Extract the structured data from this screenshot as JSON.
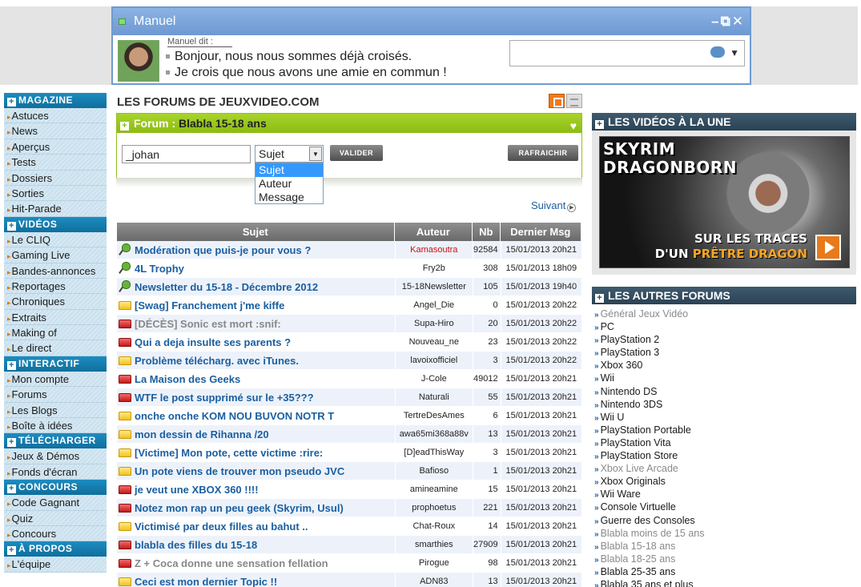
{
  "chat": {
    "contact_name": "Manuel",
    "window_controls": "–⧉✕",
    "speaker_label": "Manuel dit :",
    "messages": [
      "Bonjour, nous nous sommes déjà croisés.",
      "Je crois que nous avons une amie en commun !"
    ],
    "input_value": ""
  },
  "sidebar": {
    "sections": [
      {
        "title": "MAGAZINE",
        "items": [
          "Astuces",
          "News",
          "Aperçus",
          "Tests",
          "Dossiers",
          "Sorties",
          "Hit-Parade"
        ]
      },
      {
        "title": "VIDÉOS",
        "items": [
          "Le CLIQ",
          "Gaming Live",
          "Bandes-annonces",
          "Reportages",
          "Chroniques",
          "Extraits",
          "Making of",
          "Le direct"
        ]
      },
      {
        "title": "INTERACTIF",
        "items": [
          "Mon compte",
          "Forums",
          "Les Blogs",
          "Boîte à idées"
        ]
      },
      {
        "title": "TÉLÉCHARGER",
        "items": [
          "Jeux & Démos",
          "Fonds d'écran"
        ]
      },
      {
        "title": "CONCOURS",
        "items": [
          "Code Gagnant",
          "Quiz",
          "Concours"
        ]
      },
      {
        "title": "À PROPOS",
        "items": [
          "L'équipe"
        ]
      }
    ]
  },
  "main": {
    "title": "LES FORUMS DE JEUXVIDEO.COM",
    "forum_label": "Forum :",
    "forum_name": "Blabla 15-18 ans",
    "search_value": "_johan",
    "select_value": "Sujet",
    "select_options": [
      "Sujet",
      "Auteur",
      "Message"
    ],
    "validate_label": "VALIDER",
    "refresh_label": "RAFRAICHIR",
    "next_label": "Suivant"
  },
  "table": {
    "headers": [
      "Sujet",
      "Auteur",
      "Nb",
      "Dernier Msg"
    ],
    "rows": [
      {
        "icon": "pin",
        "subject": "Modération que puis-je pour vous ?",
        "author": "Kamasoutra",
        "author_red": true,
        "nb": "92584",
        "date": "15/01/2013 20h21"
      },
      {
        "icon": "pin",
        "subject": "4L Trophy",
        "author": "Fry2b",
        "nb": "308",
        "date": "15/01/2013 18h09"
      },
      {
        "icon": "pin",
        "subject": "Newsletter du 15-18 - Décembre 2012",
        "author": "15-18Newsletter",
        "nb": "105",
        "date": "15/01/2013 19h40"
      },
      {
        "icon": "yellow",
        "subject": "[Swag] Franchement j'me kiffe",
        "author": "Angel_Die",
        "nb": "0",
        "date": "15/01/2013 20h22"
      },
      {
        "icon": "red",
        "subject": "[DÉCÈS] Sonic est mort :snif:",
        "author": "Supa-Hiro",
        "nb": "20",
        "date": "15/01/2013 20h22",
        "gray": true
      },
      {
        "icon": "red",
        "subject": "Qui a deja insulte ses parents ?",
        "author": "Nouveau_ne",
        "nb": "23",
        "date": "15/01/2013 20h22"
      },
      {
        "icon": "yellow",
        "subject": "Problème télécharg. avec iTunes.",
        "author": "lavoixofficiel",
        "nb": "3",
        "date": "15/01/2013 20h22"
      },
      {
        "icon": "red",
        "subject": "La Maison des Geeks",
        "author": "J-Cole",
        "nb": "49012",
        "date": "15/01/2013 20h21"
      },
      {
        "icon": "red",
        "subject": "WTF le post supprimé sur le +35???",
        "author": "Naturali",
        "nb": "55",
        "date": "15/01/2013 20h21"
      },
      {
        "icon": "yellow",
        "subject": "onche onche KOM NOU BUVON NOTR T",
        "author": "TertreDesAmes",
        "nb": "6",
        "date": "15/01/2013 20h21"
      },
      {
        "icon": "yellow",
        "subject": "mon dessin de Rihanna /20",
        "author": "awa65mi368a88v",
        "nb": "13",
        "date": "15/01/2013 20h21"
      },
      {
        "icon": "yellow",
        "subject": "[Victime] Mon pote, cette victime :rire:",
        "author": "[D]eadThisWay",
        "nb": "3",
        "date": "15/01/2013 20h21"
      },
      {
        "icon": "yellow",
        "subject": "Un pote viens de trouver mon pseudo JVC",
        "author": "Bafioso",
        "nb": "1",
        "date": "15/01/2013 20h21"
      },
      {
        "icon": "red",
        "subject": "je veut une XBOX 360 !!!!",
        "author": "amineamine",
        "nb": "15",
        "date": "15/01/2013 20h21"
      },
      {
        "icon": "red",
        "subject": "Notez mon rap un peu geek (Skyrim, Usul)",
        "author": "prophoetus",
        "nb": "221",
        "date": "15/01/2013 20h21"
      },
      {
        "icon": "yellow",
        "subject": "Victimisé par deux filles au bahut ..",
        "author": "Chat-Roux",
        "nb": "14",
        "date": "15/01/2013 20h21"
      },
      {
        "icon": "red",
        "subject": "blabla des filles du 15-18",
        "author": "smarthies",
        "nb": "27909",
        "date": "15/01/2013 20h21"
      },
      {
        "icon": "red",
        "subject": "Z + Coca donne une sensation fellation",
        "author": "Pirogue",
        "nb": "98",
        "date": "15/01/2013 20h21",
        "gray": true
      },
      {
        "icon": "yellow",
        "subject": "Ceci est mon dernier Topic !!",
        "author": "ADN83",
        "nb": "13",
        "date": "15/01/2013 20h21"
      }
    ]
  },
  "right": {
    "videos_title": "LES VIDÉOS À LA UNE",
    "video_title_lines": [
      "SKYRIM",
      "DRAGONBORN"
    ],
    "video_caption_1": "SUR LES TRACES",
    "video_caption_2a": "D'UN ",
    "video_caption_2b": "PRÊTRE DRAGON",
    "forums_title": "LES AUTRES FORUMS",
    "forums": [
      {
        "name": "Général Jeux Vidéo",
        "gray": true
      },
      {
        "name": "PC"
      },
      {
        "name": "PlayStation 2"
      },
      {
        "name": "PlayStation 3"
      },
      {
        "name": "Xbox 360"
      },
      {
        "name": "Wii"
      },
      {
        "name": "Nintendo DS"
      },
      {
        "name": "Nintendo 3DS"
      },
      {
        "name": "Wii U"
      },
      {
        "name": "PlayStation Portable"
      },
      {
        "name": "PlayStation Vita"
      },
      {
        "name": "PlayStation Store"
      },
      {
        "name": "Xbox Live Arcade",
        "gray": true
      },
      {
        "name": "Xbox Originals"
      },
      {
        "name": "Wii Ware"
      },
      {
        "name": "Console Virtuelle"
      },
      {
        "name": "Guerre des Consoles"
      },
      {
        "name": "Blabla moins de 15 ans",
        "gray": true
      },
      {
        "name": "Blabla 15-18 ans",
        "gray": true
      },
      {
        "name": "Blabla 18-25 ans",
        "gray": true
      },
      {
        "name": "Blabla 25-35 ans"
      },
      {
        "name": "Blabla 35 ans et plus"
      }
    ]
  }
}
